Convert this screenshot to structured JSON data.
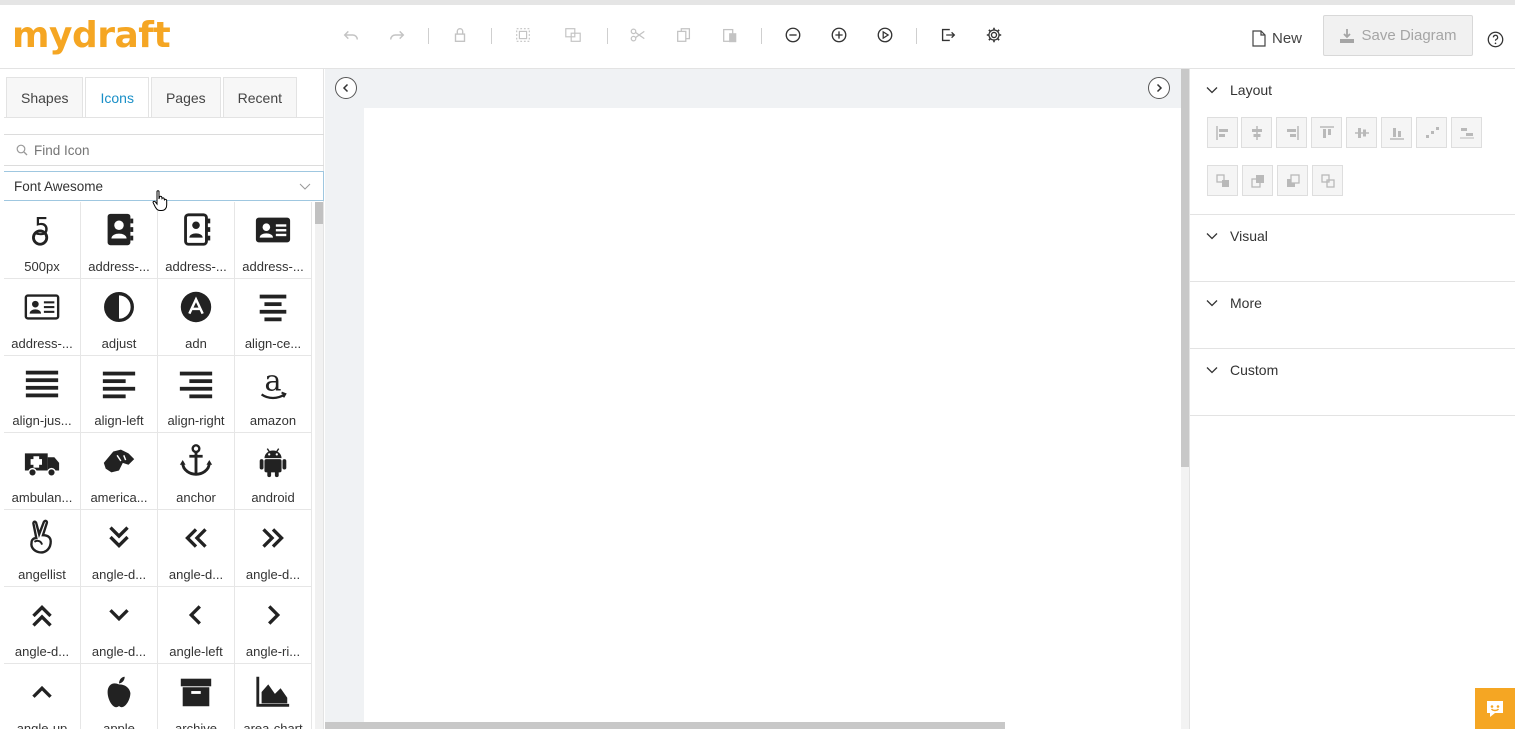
{
  "app": {
    "logo": "mydraft"
  },
  "toolbar": {
    "buttons": [
      {
        "name": "undo-icon",
        "enabled": false
      },
      {
        "name": "redo-icon",
        "enabled": false
      },
      {
        "name": "lock-icon",
        "enabled": false
      },
      {
        "name": "group-icon",
        "enabled": false
      },
      {
        "name": "ungroup-icon",
        "enabled": false
      },
      {
        "name": "cut-icon",
        "enabled": false
      },
      {
        "name": "copy-icon",
        "enabled": false
      },
      {
        "name": "paste-icon",
        "enabled": false
      },
      {
        "name": "zoom-out-icon",
        "enabled": true
      },
      {
        "name": "zoom-in-icon",
        "enabled": true
      },
      {
        "name": "play-icon",
        "enabled": true
      },
      {
        "name": "export-icon",
        "enabled": true
      },
      {
        "name": "settings-icon",
        "enabled": true
      }
    ],
    "new_label": "New",
    "save_label": "Save Diagram",
    "help_icon": "help-icon"
  },
  "left": {
    "tabs": [
      {
        "label": "Shapes",
        "active": false
      },
      {
        "label": "Icons",
        "active": true
      },
      {
        "label": "Pages",
        "active": false
      },
      {
        "label": "Recent",
        "active": false
      }
    ],
    "search": {
      "placeholder": "Find Icon",
      "value": ""
    },
    "icon_set": "Font Awesome",
    "icons": [
      {
        "label": "500px",
        "icon": "500px-icon"
      },
      {
        "label": "address-...",
        "icon": "address-book-icon"
      },
      {
        "label": "address-...",
        "icon": "address-book-o-icon"
      },
      {
        "label": "address-...",
        "icon": "address-card-icon"
      },
      {
        "label": "address-...",
        "icon": "address-card-o-icon"
      },
      {
        "label": "adjust",
        "icon": "adjust-icon"
      },
      {
        "label": "adn",
        "icon": "adn-icon"
      },
      {
        "label": "align-ce...",
        "icon": "align-center-icon"
      },
      {
        "label": "align-jus...",
        "icon": "align-justify-icon"
      },
      {
        "label": "align-left",
        "icon": "align-left-icon"
      },
      {
        "label": "align-right",
        "icon": "align-right-icon"
      },
      {
        "label": "amazon",
        "icon": "amazon-icon"
      },
      {
        "label": "ambulan...",
        "icon": "ambulance-icon"
      },
      {
        "label": "america...",
        "icon": "american-sign-language-icon"
      },
      {
        "label": "anchor",
        "icon": "anchor-icon"
      },
      {
        "label": "android",
        "icon": "android-icon"
      },
      {
        "label": "angellist",
        "icon": "angellist-icon"
      },
      {
        "label": "angle-d...",
        "icon": "angle-double-down-icon"
      },
      {
        "label": "angle-d...",
        "icon": "angle-double-left-icon"
      },
      {
        "label": "angle-d...",
        "icon": "angle-double-right-icon"
      },
      {
        "label": "angle-d...",
        "icon": "angle-double-up-icon"
      },
      {
        "label": "angle-d...",
        "icon": "angle-down-icon"
      },
      {
        "label": "angle-left",
        "icon": "angle-left-icon"
      },
      {
        "label": "angle-ri...",
        "icon": "angle-right-icon"
      },
      {
        "label": "angle-up",
        "icon": "angle-up-icon"
      },
      {
        "label": "apple",
        "icon": "apple-icon"
      },
      {
        "label": "archive",
        "icon": "archive-icon"
      },
      {
        "label": "area-chart",
        "icon": "area-chart-icon"
      }
    ]
  },
  "right": {
    "sections": [
      {
        "label": "Layout"
      },
      {
        "label": "Visual"
      },
      {
        "label": "More"
      },
      {
        "label": "Custom"
      }
    ]
  },
  "colors": {
    "brand": "#f5a623",
    "active_tab": "#1a8fc7",
    "icon": "#222222"
  }
}
